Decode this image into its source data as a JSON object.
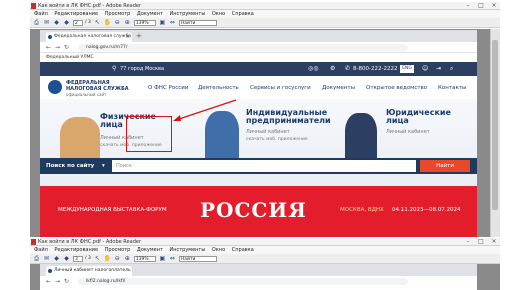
{
  "window1": {
    "title": "Как войти в ЛК ФНС.pdf - Adobe Reader",
    "menu": [
      "Файл",
      "Редактирование",
      "Просмотр",
      "Документ",
      "Инструменты",
      "Окно",
      "Справка"
    ],
    "toolbar": {
      "page_current": "2",
      "page_total": "/ 3",
      "zoom": "139%",
      "find": "Найти"
    }
  },
  "browser": {
    "tab_title": "Федеральная налоговая служба",
    "tab_close": "×",
    "new_tab": "+",
    "url": "nalog.gov.ru/rn77/",
    "bookmark": "Федеральный УЛМС"
  },
  "site": {
    "region": "77 город Москва",
    "phone": "8-800-222-2222",
    "lang_btn": "ENG",
    "logo_line1": "ФЕДЕРАЛЬНАЯ",
    "logo_line2": "НАЛОГОВАЯ СЛУЖБА",
    "logo_line3": "официальный сайт",
    "nav": [
      "О ФНС России",
      "Деятельность",
      "Сервисы и госуслуги",
      "Документы",
      "Открытое ведомство",
      "Контакты"
    ],
    "hero": [
      {
        "title": "Физические\nлица",
        "cabinet": "Личный кабинет",
        "sub": "скачать моб. приложение"
      },
      {
        "title": "Индивидуальные\nпредприниматели",
        "cabinet": "Личный кабинет",
        "sub": "скачать моб. приложение"
      },
      {
        "title": "Юридические\nлица",
        "cabinet": "Личный кабинет",
        "sub": ""
      }
    ],
    "search": {
      "label": "Поиск по сайту",
      "placeholder": "Поиск",
      "button": "Найти"
    },
    "promo": {
      "left": "МЕЖДУНАРОДНАЯ ВЫСТАВКА-ФОРУМ",
      "center": "РОССИЯ",
      "place": "МОСКВА, ВДНХ",
      "dates": "04.11.2023—08.07.2024"
    }
  },
  "window2": {
    "title": "Как войти в ЛК ФНС.pdf - Adobe Reader",
    "menu": [
      "Файл",
      "Редактирование",
      "Просмотр",
      "Документ",
      "Инструменты",
      "Окно",
      "Справка"
    ],
    "toolbar": {
      "page_current": "3",
      "page_total": "/ 3",
      "zoom": "139%",
      "find": "Найти"
    },
    "tab_title": "Личный кабинет налогоплатель",
    "url": "lkfl2.nalog.ru/lkfl/"
  },
  "colors": {
    "site_dark": "#2c3e62",
    "promo_red": "#e31d2b",
    "search_bg": "#1f3a5f",
    "find_button": "#e8482b"
  }
}
